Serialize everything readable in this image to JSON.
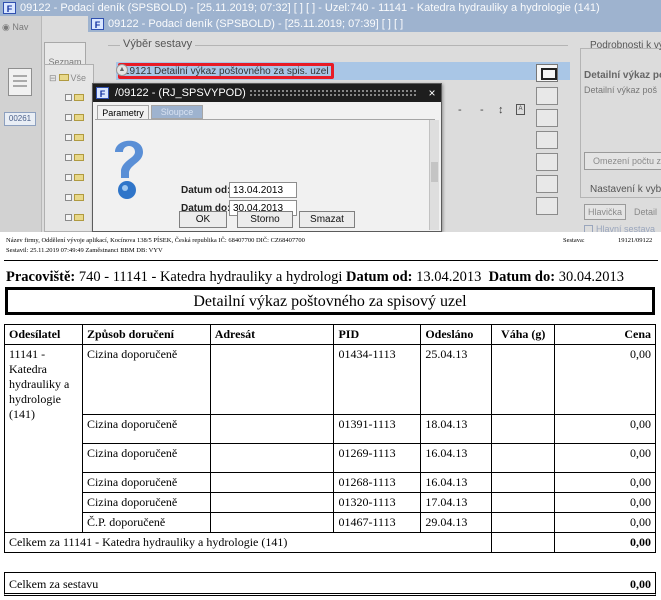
{
  "window": {
    "title_back": "09122 - Podací deník (SPSBOLD) - [25.11.2019; 07:32]  [ ]  [ ] - Uzel:740 - 11141 - Katedra hydrauliky a hydrologie (141)",
    "title_front": "09122 - Podací deník (SPSBOLD) - [25.11.2019; 07:39]  [ ]  [ ]",
    "logo": "F"
  },
  "sidebar": {
    "nav_label": "Nav",
    "seznam_label": "Seznam",
    "number_box": "00261",
    "tree_root": "Vše"
  },
  "vyber": {
    "legend": "Výběr sestavy",
    "selected_code": "19121",
    "selected_name": "Detailní výkaz poštovného za spis. uzel",
    "tools": [
      "-",
      "-",
      "↕",
      "pdf-icon",
      "monitor-icon"
    ]
  },
  "detail": {
    "legend": "Podrobnosti k výb",
    "title": "Detailní výkaz poš",
    "subtitle": "Detailní výkaz poš",
    "omezeni_label": "Omezení počtu za",
    "nastaveni_legend": "Nastavení k vybr",
    "hlavicka_label": "Hlavička",
    "detail_text": "Detail",
    "hlavni_label": "Hlavní sestava"
  },
  "dialog": {
    "title": "/09122 - (RJ_SPSVYPOD)",
    "close": "×",
    "tab_params": "Parametry",
    "tab_cols": "Sloupce",
    "label_from": "Datum od:",
    "label_to": "Datum do:",
    "value_from": "13.04.2013",
    "value_to": "30.04.2013",
    "btn_ok": "OK",
    "btn_storno": "Storno",
    "btn_smazat": "Smazat"
  },
  "report": {
    "header_line1": "Název firmy, Oddělení vývoje aplikací, Kocínova 138/5 PÍSEK, Česká republika  IČ: 68407700  DIČ: CZ68407700",
    "header_line2": "Sestavil: 25.11.2019 07:49:49 Zaměstnanci BBM  DB: VYV",
    "sestava_label": "Sestava:",
    "sestava_value": "19121/09122",
    "workplace_label": "Pracoviště:",
    "workplace_value": "740 - 11141 - Katedra hydrauliky a hydrologi",
    "date_from_label": "Datum od:",
    "date_from_value": "13.04.2013",
    "date_to_label": "Datum do:",
    "date_to_value": "30.04.2013",
    "title": "Detailní výkaz poštovného za spisový uzel",
    "columns": [
      "Odesílatel",
      "Způsob doručení",
      "Adresát",
      "PID",
      "Odesláno",
      "Váha (g)",
      "Cena"
    ],
    "sender": "11141 - Katedra hydrauliky a hydrologie (141)",
    "rows": [
      {
        "way": "Cizina doporučeně",
        "addr": "",
        "pid": "01434-1113",
        "sent": "25.04.13",
        "weight": "",
        "price": "0,00"
      },
      {
        "way": "Cizina doporučeně",
        "addr": "",
        "pid": "01391-1113",
        "sent": "18.04.13",
        "weight": "",
        "price": "0,00"
      },
      {
        "way": "Cizina doporučeně",
        "addr": "",
        "pid": "01269-1113",
        "sent": "16.04.13",
        "weight": "",
        "price": "0,00"
      },
      {
        "way": "Cizina doporučeně",
        "addr": "",
        "pid": "01268-1113",
        "sent": "16.04.13",
        "weight": "",
        "price": "0,00"
      },
      {
        "way": "Cizina doporučeně",
        "addr": "",
        "pid": "01320-1113",
        "sent": "17.04.13",
        "weight": "",
        "price": "0,00"
      },
      {
        "way": "Č.P. doporučeně",
        "addr": "",
        "pid": "01467-1113",
        "sent": "29.04.13",
        "weight": "",
        "price": "0,00"
      }
    ],
    "subtotal_label": "Celkem za 11141 - Katedra hydrauliky a hydrologie (141)",
    "subtotal_value": "0,00",
    "total_label": "Celkem za sestavu",
    "total_value": "0,00"
  }
}
